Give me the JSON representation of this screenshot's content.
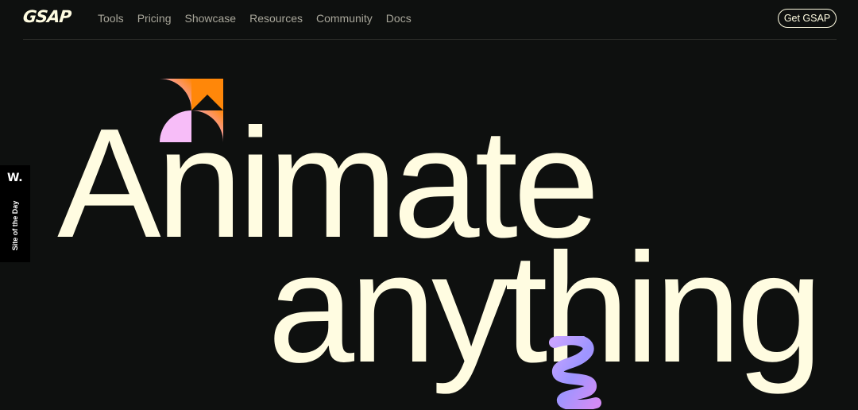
{
  "header": {
    "logo": "GSAP",
    "nav": [
      "Tools",
      "Pricing",
      "Showcase",
      "Resources",
      "Community",
      "Docs"
    ],
    "cta_label": "Get GSAP"
  },
  "side_badge": {
    "logo": "W.",
    "label": "Site of the Day"
  },
  "hero": {
    "line1": "Animate",
    "line2": "anything"
  },
  "colors": {
    "background": "#0e100f",
    "text": "#fffce1",
    "nav_text": "#a8a69a",
    "pinwheel_orange": "#ff8709",
    "pinwheel_pink": "#f7bdf8",
    "squiggle_purple": "#9d95ff"
  },
  "icons": [
    "pinwheel-icon",
    "squiggle-icon"
  ]
}
